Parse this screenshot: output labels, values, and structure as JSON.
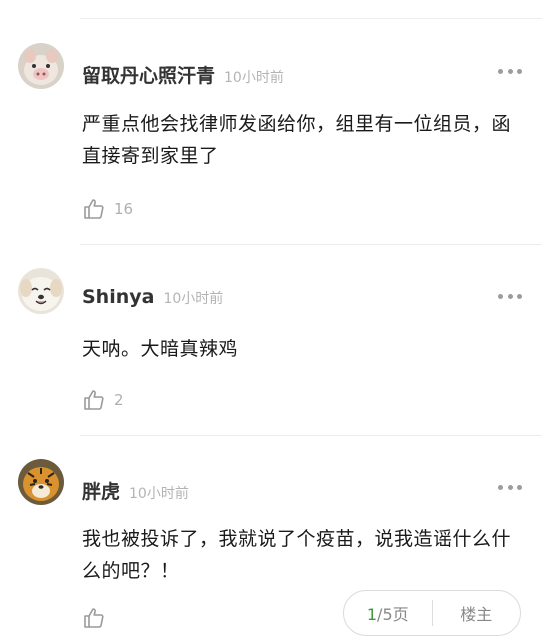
{
  "comments": [
    {
      "avatar_icon": "pig-avatar-icon",
      "name": "留取丹心照汗青",
      "time": "10小时前",
      "text": "严重点他会找律师发函给你，组里有一位组员，函直接寄到家里了",
      "likes": "16"
    },
    {
      "avatar_icon": "dog-avatar-icon",
      "name": "Shinya",
      "time": "10小时前",
      "text": "天呐。大暗真辣鸡",
      "likes": "2"
    },
    {
      "avatar_icon": "tiger-avatar-icon",
      "name": "胖虎",
      "time": "10小时前",
      "text": "我也被投诉了，我就说了个疫苗，说我造谣什么什么的吧？！",
      "likes": ""
    }
  ],
  "pager": {
    "current": "1",
    "total_suffix": "/5页",
    "owner_label": "楼主"
  },
  "colors": {
    "accent_green": "#3c9a3c",
    "meta_gray": "#b4b4b4",
    "divider": "#ececec"
  }
}
